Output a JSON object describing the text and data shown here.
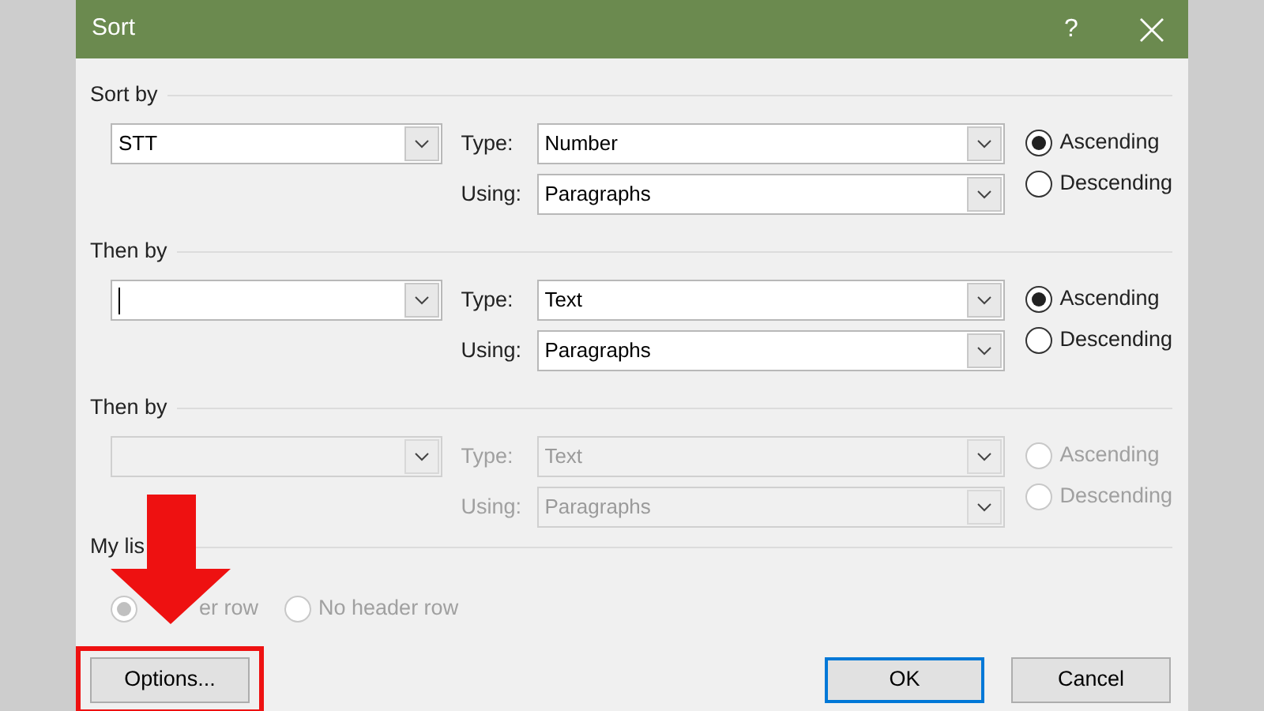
{
  "window": {
    "title": "Sort",
    "help": "?"
  },
  "sort_levels": [
    {
      "heading": "Sort by",
      "disabled": false,
      "field": {
        "value": "STT"
      },
      "type_label": "Type:",
      "type": "Number",
      "using_label": "Using:",
      "using": "Paragraphs",
      "order": [
        {
          "label": "Ascending",
          "selected": true
        },
        {
          "label": "Descending",
          "selected": false
        }
      ]
    },
    {
      "heading": "Then by",
      "disabled": false,
      "field": {
        "focused": true
      },
      "type_label": "Type:",
      "type": "Text",
      "using_label": "Using:",
      "using": "Paragraphs",
      "order": [
        {
          "label": "Ascending",
          "selected": true
        },
        {
          "label": "Descending",
          "selected": false
        }
      ]
    },
    {
      "heading": "Then by",
      "disabled": true,
      "type_label": "Type:",
      "type": "Text",
      "using_label": "Using:",
      "using": "Paragraphs",
      "order": [
        {
          "label": "Ascending",
          "selected": false
        },
        {
          "label": "Descending",
          "selected": false
        }
      ]
    }
  ],
  "header_options": {
    "heading": "My lis",
    "disabled": true,
    "options": [
      {
        "label": "er row",
        "selected": true
      },
      {
        "label": "No header row",
        "selected": false
      }
    ]
  },
  "buttons": [
    {
      "label": "Options...",
      "highlighted": true,
      "default": false
    },
    {
      "label": "OK",
      "highlighted": false,
      "default": true
    },
    {
      "label": "Cancel",
      "highlighted": false,
      "default": false
    }
  ]
}
